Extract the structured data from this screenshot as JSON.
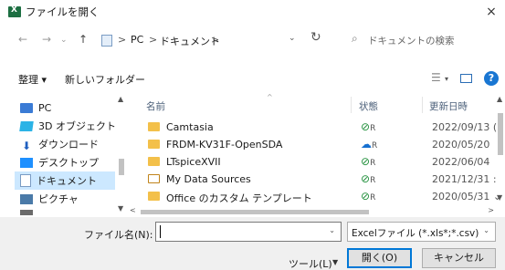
{
  "window": {
    "title": "ファイルを開く",
    "close_glyph": "×"
  },
  "nav": {
    "back": "←",
    "forward": "→",
    "dropdown": "⌄",
    "up": "↑"
  },
  "address": {
    "sep": ">",
    "segments": [
      "PC",
      "ドキュメント"
    ],
    "dropdown": "⌄",
    "refresh": "↻"
  },
  "search": {
    "icon": "⌕",
    "placeholder": "ドキュメントの検索"
  },
  "toolbar": {
    "organize": "整理 ▾",
    "new_folder": "新しいフォルダー",
    "view_icon": "☰",
    "view_dropdown": "▾",
    "help": "?"
  },
  "tree": [
    {
      "label": "PC",
      "icon": "pc-icon"
    },
    {
      "label": "3D オブジェクト",
      "icon": "3d-objects-icon"
    },
    {
      "label": "ダウンロード",
      "icon": "download-icon",
      "glyph": "⬇"
    },
    {
      "label": "デスクトップ",
      "icon": "desktop-icon"
    },
    {
      "label": "ドキュメント",
      "icon": "document-icon",
      "selected": true
    },
    {
      "label": "ピクチャ",
      "icon": "pictures-icon"
    }
  ],
  "columns": {
    "name": "名前",
    "sort": "^",
    "status": "状態",
    "date": "更新日時"
  },
  "files": [
    {
      "name": "Camtasia",
      "status": "⊘",
      "status_type": "ok",
      "person": "R",
      "date": "2022/09/13 ("
    },
    {
      "name": "FRDM-KV31F-OpenSDA",
      "status": "☁",
      "status_type": "cloud",
      "person": "R",
      "date": "2020/05/20"
    },
    {
      "name": "LTspiceXVII",
      "status": "⊘",
      "status_type": "ok",
      "person": "R",
      "date": "2022/06/04"
    },
    {
      "name": "My Data Sources",
      "status": "⊘",
      "status_type": "ok",
      "person": "R",
      "date": "2021/12/31 :"
    },
    {
      "name": "Office のカスタム テンプレート",
      "status": "⊘",
      "status_type": "ok",
      "person": "R",
      "date": "2020/05/31 ⌄"
    }
  ],
  "scroll": {
    "up": "▲",
    "down": "▼",
    "left": "<",
    "right": ">"
  },
  "bottom": {
    "filename_label": "ファイル名(N):",
    "filename_value": "",
    "filename_dropdown": "⌄",
    "filetype": "Excelファイル (*.xls*;*.csv)",
    "filetype_dropdown": "⌄",
    "tools": "ツール(L)",
    "tools_dropdown": "▼",
    "open": "開く(O)",
    "cancel": "キャンセル"
  },
  "colors": {
    "accent": "#0078d7",
    "selection": "#cce8ff",
    "excel": "#1d6f42",
    "folder": "#f3c04a"
  }
}
